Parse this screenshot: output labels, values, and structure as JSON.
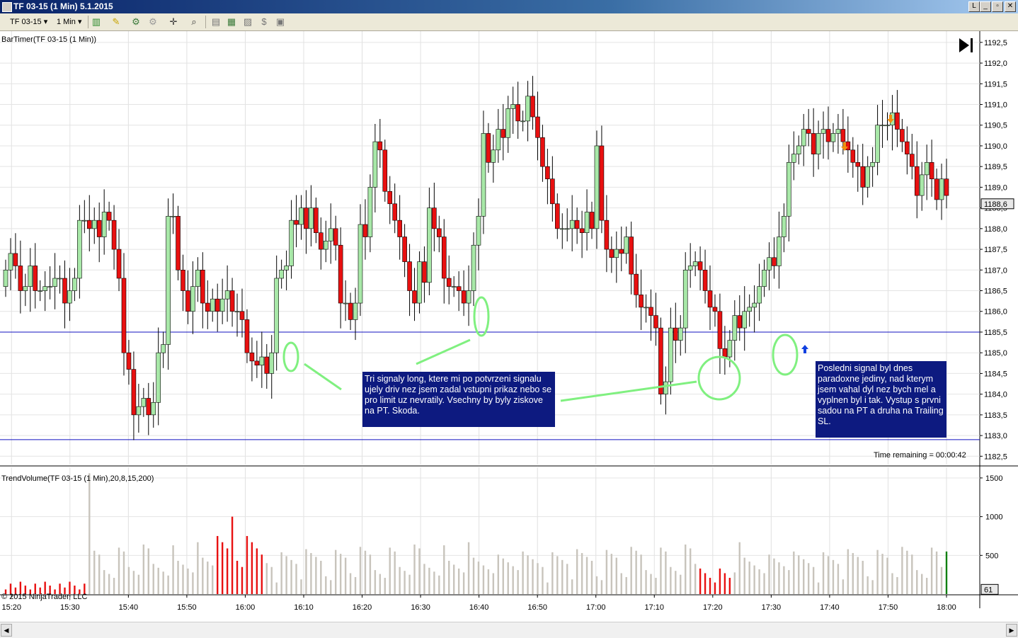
{
  "window": {
    "title": "TF 03-15 (1 Min)  5.1.2015",
    "buttons": [
      "L",
      "_",
      "▫",
      "✕"
    ]
  },
  "toolbar": {
    "instrument": "TF 03-15",
    "interval": "1 Min"
  },
  "price_panel": {
    "indicator_label": "BarTimer(TF 03-15 (1 Min))",
    "time_remaining": "Time remaining = 00:00:42",
    "last_price_label": "1188,6"
  },
  "volume_panel": {
    "indicator_label": "TrendVolume(TF 03-15 (1 Min),20,8,15,200)",
    "last_volume_label": "61",
    "copyright": "© 2015 NinjaTrader, LLC"
  },
  "annotations": {
    "note_left": "Tri signaly long, ktere mi po potvrzeni signalu ujely driv nez jsem zadal vstupni prikaz nebo se pro limit uz nevratily. Vsechny by byly ziskove na PT. Skoda.",
    "note_right": "Posledni signal byl dnes paradoxne jediny, nad kterym jsem vahal dyl nez bych mel a vyplnen byl i tak. Vystup s prvni sadou na PT a druha na Trailing SL."
  },
  "colors": {
    "up": "#a8e8a8",
    "down": "#e81010",
    "hline": "#1010c0",
    "neutral_volume": "#c8c4bc",
    "note_bg": "#0d1a80",
    "highlight": "#80f080",
    "arrow_up": "#1040e0",
    "arrow_down": "#f09010"
  },
  "chart_data": [
    {
      "type": "candlestick",
      "y_ticks": [
        "1182,5",
        "1183,0",
        "1183,5",
        "1184,0",
        "1184,5",
        "1185,0",
        "1185,5",
        "1186,0",
        "1186,5",
        "1187,0",
        "1187,5",
        "1188,0",
        "1188,5",
        "1189,0",
        "1189,5",
        "1190,0",
        "1190,5",
        "1191,0",
        "1191,5",
        "1192,0",
        "1192,5"
      ],
      "ylim": [
        1182.3,
        1192.6
      ],
      "x_ticks": [
        "15:20",
        "15:30",
        "15:40",
        "15:50",
        "16:00",
        "16:10",
        "16:20",
        "16:30",
        "16:40",
        "16:50",
        "17:00",
        "17:10",
        "17:20",
        "17:30",
        "17:40",
        "17:50",
        "18:00"
      ],
      "x_start": "15:19",
      "x_end": "18:00",
      "horizontal_lines": [
        1185.5,
        1182.9
      ],
      "ohlc_close": [
        1187.0,
        1187.4,
        1187.1,
        1186.5,
        1186.6,
        1187.1,
        1186.5,
        1186.5,
        1186.6,
        1186.6,
        1186.8,
        1186.8,
        1186.2,
        1186.5,
        1186.8,
        1188.2,
        1188.2,
        1188.0,
        1188.2,
        1187.8,
        1188.4,
        1188.2,
        1187.5,
        1186.8,
        1185.0,
        1184.6,
        1183.5,
        1183.7,
        1183.9,
        1183.5,
        1183.8,
        1185.0,
        1185.2,
        1188.3,
        1188.3,
        1187.0,
        1186.5,
        1186.0,
        1186.6,
        1187.0,
        1186.2,
        1186.0,
        1186.3,
        1186.0,
        1186.3,
        1186.5,
        1186.0,
        1186.0,
        1185.8,
        1185.0,
        1184.8,
        1184.7,
        1184.9,
        1184.5,
        1185.0,
        1186.8,
        1187.0,
        1187.1,
        1188.2,
        1188.1,
        1188.5,
        1188.0,
        1188.5,
        1187.9,
        1187.5,
        1187.7,
        1188.0,
        1187.6,
        1186.2,
        1186.2,
        1185.8,
        1186.2,
        1188.1,
        1187.8,
        1189.0,
        1190.1,
        1189.9,
        1188.9,
        1188.6,
        1188.2,
        1187.8,
        1187.2,
        1186.5,
        1186.2,
        1187.2,
        1186.7,
        1188.5,
        1188.0,
        1187.8,
        1186.8,
        1186.6,
        1186.6,
        1186.5,
        1186.2,
        1186.5,
        1187.6,
        1188.3,
        1190.3,
        1189.6,
        1189.9,
        1190.4,
        1190.2,
        1190.9,
        1191.0,
        1190.6,
        1190.6,
        1191.2,
        1190.7,
        1190.2,
        1189.5,
        1189.2,
        1188.6,
        1188.0,
        1188.0,
        1188.0,
        1188.2,
        1188.0,
        1187.9,
        1188.4,
        1188.0,
        1190.0,
        1188.2,
        1187.5,
        1187.3,
        1187.5,
        1187.4,
        1187.8,
        1186.9,
        1186.4,
        1186.1,
        1186.1,
        1185.9,
        1185.6,
        1184.0,
        1184.3,
        1185.6,
        1185.3,
        1185.6,
        1187.0,
        1187.1,
        1187.2,
        1187.0,
        1186.5,
        1186.1,
        1186.0,
        1185.1,
        1184.9,
        1185.3,
        1185.9,
        1185.6,
        1186.0,
        1186.1,
        1186.2,
        1186.6,
        1187.0,
        1187.3,
        1187.1,
        1187.8,
        1188.3,
        1189.6,
        1189.8,
        1190.0,
        1190.4,
        1190.3,
        1189.8,
        1190.3,
        1190.4,
        1190.1,
        1190.3,
        1190.4,
        1190.1,
        1189.9,
        1189.6,
        1189.5,
        1189.0,
        1189.5,
        1189.6,
        1190.5,
        1190.5,
        1190.5,
        1190.8,
        1190.4,
        1190.1,
        1189.8,
        1189.5,
        1188.8,
        1189.3,
        1189.6,
        1189.2,
        1188.7,
        1189.2,
        1188.8
      ],
      "ohlc_open": [
        1186.6,
        1187.0,
        1187.4,
        1187.1,
        1186.5,
        1186.6,
        1187.1,
        1186.5,
        1186.5,
        1186.6,
        1186.6,
        1186.8,
        1186.8,
        1186.2,
        1186.5,
        1186.8,
        1188.2,
        1188.2,
        1188.0,
        1188.2,
        1187.8,
        1188.4,
        1188.2,
        1187.5,
        1186.8,
        1185.0,
        1184.6,
        1183.5,
        1183.7,
        1183.9,
        1183.5,
        1183.8,
        1185.0,
        1185.2,
        1188.3,
        1188.3,
        1187.0,
        1186.5,
        1186.0,
        1186.6,
        1187.0,
        1186.2,
        1186.0,
        1186.3,
        1186.0,
        1186.3,
        1186.5,
        1186.0,
        1186.0,
        1185.8,
        1185.0,
        1184.8,
        1184.7,
        1184.9,
        1184.5,
        1185.0,
        1186.8,
        1187.0,
        1187.1,
        1188.2,
        1188.1,
        1188.5,
        1188.0,
        1188.5,
        1187.9,
        1187.5,
        1187.7,
        1188.0,
        1187.6,
        1186.2,
        1186.2,
        1185.8,
        1186.2,
        1188.1,
        1187.8,
        1189.0,
        1190.1,
        1189.9,
        1188.9,
        1188.6,
        1188.2,
        1187.8,
        1187.2,
        1186.5,
        1186.2,
        1187.2,
        1186.7,
        1188.5,
        1188.0,
        1187.8,
        1186.8,
        1186.6,
        1186.6,
        1186.5,
        1186.2,
        1186.5,
        1187.6,
        1188.3,
        1190.3,
        1189.6,
        1189.9,
        1190.4,
        1190.2,
        1190.9,
        1191.0,
        1190.6,
        1190.6,
        1191.2,
        1190.7,
        1190.2,
        1189.5,
        1189.2,
        1188.6,
        1188.0,
        1188.0,
        1188.0,
        1188.2,
        1188.0,
        1187.9,
        1188.4,
        1188.0,
        1190.0,
        1188.2,
        1187.5,
        1187.3,
        1187.5,
        1187.4,
        1187.8,
        1186.9,
        1186.4,
        1186.1,
        1186.1,
        1185.9,
        1185.6,
        1184.0,
        1184.3,
        1185.6,
        1185.3,
        1185.6,
        1187.0,
        1187.1,
        1187.2,
        1187.0,
        1186.5,
        1186.1,
        1186.0,
        1185.1,
        1184.9,
        1185.3,
        1185.9,
        1185.6,
        1186.0,
        1186.1,
        1186.2,
        1186.6,
        1187.0,
        1187.3,
        1187.1,
        1187.8,
        1188.3,
        1189.6,
        1189.8,
        1190.0,
        1190.4,
        1190.3,
        1189.8,
        1190.3,
        1190.4,
        1190.1,
        1190.3,
        1190.4,
        1190.1,
        1189.9,
        1189.6,
        1189.5,
        1189.0,
        1189.5,
        1189.6,
        1190.5,
        1190.5,
        1190.5,
        1190.8,
        1190.4,
        1190.1,
        1189.8,
        1189.5,
        1188.8,
        1189.3,
        1189.6,
        1189.2,
        1188.7,
        1189.2
      ]
    },
    {
      "type": "bar",
      "name": "TrendVolume",
      "y_ticks": [
        "500",
        "1000",
        "1500"
      ],
      "ylim": [
        0,
        1600
      ],
      "last_value": 61
    }
  ]
}
